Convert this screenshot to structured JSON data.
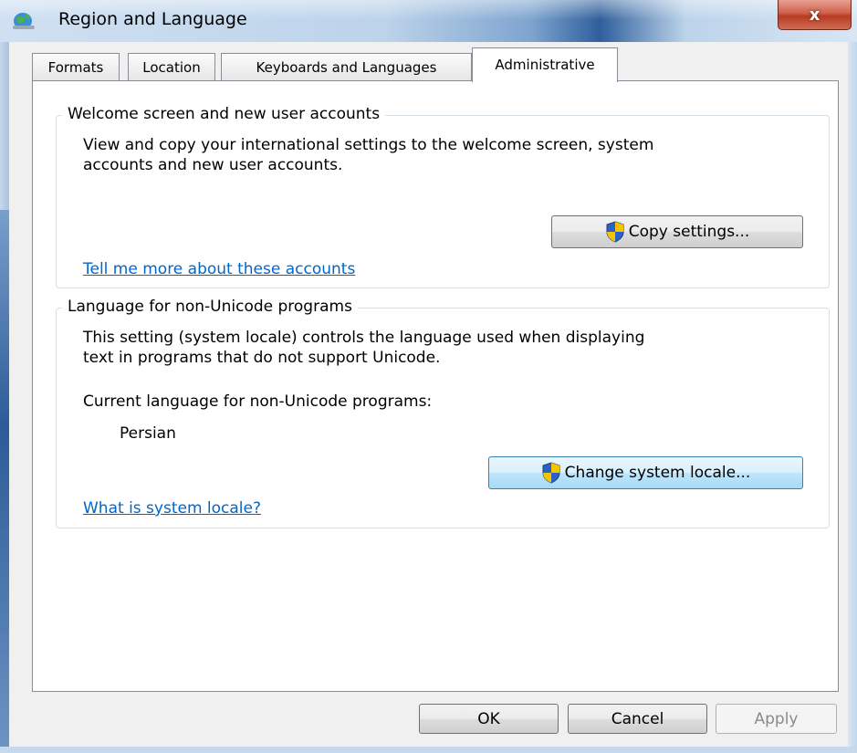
{
  "window": {
    "title": "Region and Language",
    "close_label": "x"
  },
  "tabs": [
    {
      "label": "Formats",
      "active": false
    },
    {
      "label": "Location",
      "active": false
    },
    {
      "label": "Keyboards and Languages",
      "active": false
    },
    {
      "label": "Administrative",
      "active": true
    }
  ],
  "welcome_group": {
    "legend": "Welcome screen and new user accounts",
    "description_line1": "View and copy your international settings to the welcome screen, system",
    "description_line2": "accounts and new user accounts.",
    "copy_button": "Copy settings...",
    "link": "Tell me more about these accounts"
  },
  "locale_group": {
    "legend": "Language for non-Unicode programs",
    "description_line1": "This setting (system locale) controls the language used when displaying",
    "description_line2": "text in programs that do not support Unicode.",
    "current_label": "Current language for non-Unicode programs:",
    "current_value": "Persian",
    "change_button": "Change system locale...",
    "link": "What is system locale?"
  },
  "footer": {
    "ok": "OK",
    "cancel": "Cancel",
    "apply": "Apply"
  },
  "icons": {
    "app": "globe-icon",
    "shield": "uac-shield-icon"
  }
}
